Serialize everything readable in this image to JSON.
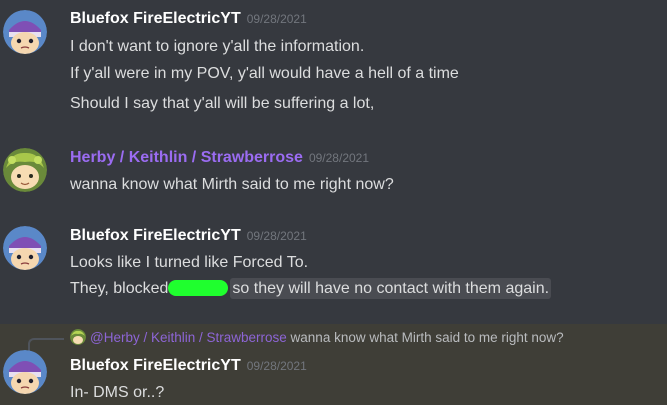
{
  "messages": [
    {
      "author": "Bluefox FireElectricYT",
      "author_color": "#ffffff",
      "avatar": "bluefox-avatar",
      "timestamp": "09/28/2021",
      "lines": [
        "I don't want to ignore y'all the information.",
        "If y'all were in my POV, y'all would have a hell of a time",
        "Should I say that y'all will be suffering a lot,"
      ]
    },
    {
      "author": "Herby / Keithlin / Strawberrose",
      "author_color": "#9b6cf2",
      "avatar": "herby-avatar",
      "timestamp": "09/28/2021",
      "lines": [
        "wanna know what Mirth said to me right now?"
      ]
    },
    {
      "author": "Bluefox FireElectricYT",
      "author_color": "#ffffff",
      "avatar": "bluefox-avatar",
      "timestamp": "09/28/2021",
      "lines": [
        "Looks like I turned like Forced To."
      ],
      "highlighted_line": {
        "before": "They, blocked",
        "after": "so they will have no contact with them again."
      },
      "censor_color": "#1fff2e"
    },
    {
      "reply": {
        "mention": "@Herby / Keithlin / Strawberrose",
        "text": "wanna know what Mirth said to me right now?"
      },
      "author": "Bluefox FireElectricYT",
      "author_color": "#ffffff",
      "avatar": "bluefox-avatar",
      "timestamp": "09/28/2021",
      "lines": [
        "In- DMS or..?"
      ]
    }
  ]
}
